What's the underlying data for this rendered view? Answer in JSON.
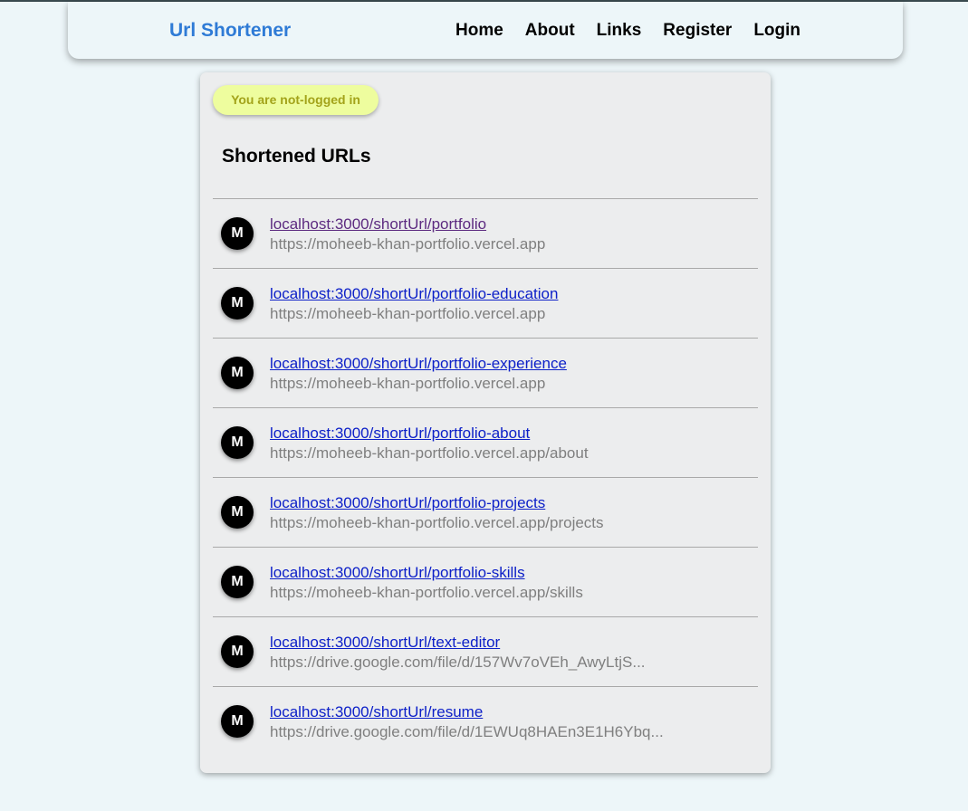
{
  "navbar": {
    "brand": "Url Shortener",
    "links": [
      {
        "label": "Home"
      },
      {
        "label": "About"
      },
      {
        "label": "Links"
      },
      {
        "label": "Register"
      },
      {
        "label": "Login"
      }
    ]
  },
  "status": {
    "text": "You are not-logged in",
    "color": "#eefd9e"
  },
  "main": {
    "title": "Shortened URLs",
    "items": [
      {
        "avatar": "M",
        "short_url": "localhost:3000/shortUrl/portfolio",
        "original_url": "https://moheeb-khan-portfolio.vercel.app",
        "visited": true
      },
      {
        "avatar": "M",
        "short_url": "localhost:3000/shortUrl/portfolio-education",
        "original_url": "https://moheeb-khan-portfolio.vercel.app",
        "visited": false
      },
      {
        "avatar": "M",
        "short_url": "localhost:3000/shortUrl/portfolio-experience",
        "original_url": "https://moheeb-khan-portfolio.vercel.app",
        "visited": false
      },
      {
        "avatar": "M",
        "short_url": "localhost:3000/shortUrl/portfolio-about",
        "original_url": "https://moheeb-khan-portfolio.vercel.app/about",
        "visited": false
      },
      {
        "avatar": "M",
        "short_url": "localhost:3000/shortUrl/portfolio-projects",
        "original_url": "https://moheeb-khan-portfolio.vercel.app/projects",
        "visited": false
      },
      {
        "avatar": "M",
        "short_url": "localhost:3000/shortUrl/portfolio-skills",
        "original_url": "https://moheeb-khan-portfolio.vercel.app/skills",
        "visited": false
      },
      {
        "avatar": "M",
        "short_url": "localhost:3000/shortUrl/text-editor",
        "original_url": "https://drive.google.com/file/d/157Wv7oVEh_AwyLtjS...",
        "visited": false
      },
      {
        "avatar": "M",
        "short_url": "localhost:3000/shortUrl/resume",
        "original_url": "https://drive.google.com/file/d/1EWUq8HAEn3E1H6Ybq...",
        "visited": false
      }
    ]
  },
  "colors": {
    "brand": "#2f7bd6",
    "link": "#0d20c8",
    "link_visited": "#5c2a80",
    "background": "#edf6f9",
    "card": "#ecedee"
  }
}
